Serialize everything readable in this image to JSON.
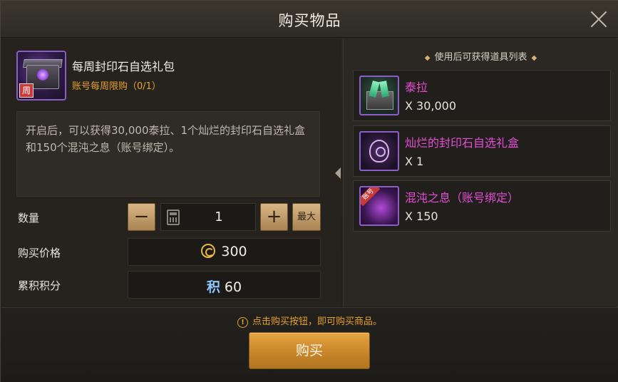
{
  "dialog": {
    "title": "购买物品"
  },
  "item": {
    "name": "每周封印石自选礼包",
    "limit": "账号每周限购（0/1）",
    "week_tag": "周",
    "description": "开启后，可以获得30,000泰拉、1个灿烂的封印石自选礼盒和150个混沌之息（账号绑定）。"
  },
  "quantity": {
    "label": "数量",
    "minus": "−",
    "plus": "+",
    "value": "1",
    "max_label": "最大"
  },
  "price": {
    "label": "购买价格",
    "value": "300"
  },
  "points": {
    "label": "累积积分",
    "icon_text": "积",
    "value": "60"
  },
  "reward_list": {
    "header": "使用后可获得道具列表",
    "items": [
      {
        "name": "泰拉",
        "qty": "X 30,000",
        "icon": "thera-crate-icon"
      },
      {
        "name": "灿烂的封印石自选礼盒",
        "qty": "X 1",
        "icon": "seal-box-icon"
      },
      {
        "name": "混沌之息（账号绑定）",
        "qty": "X 150",
        "icon": "chaos-breath-icon",
        "tag": "账号"
      }
    ]
  },
  "footer": {
    "notice": "点击购买按钮，即可购买商品。",
    "buy_label": "购买"
  },
  "colors": {
    "accent_orange": "#e6a02e",
    "item_name_pink": "#e54dd5",
    "button_gold": "#d9b784"
  }
}
